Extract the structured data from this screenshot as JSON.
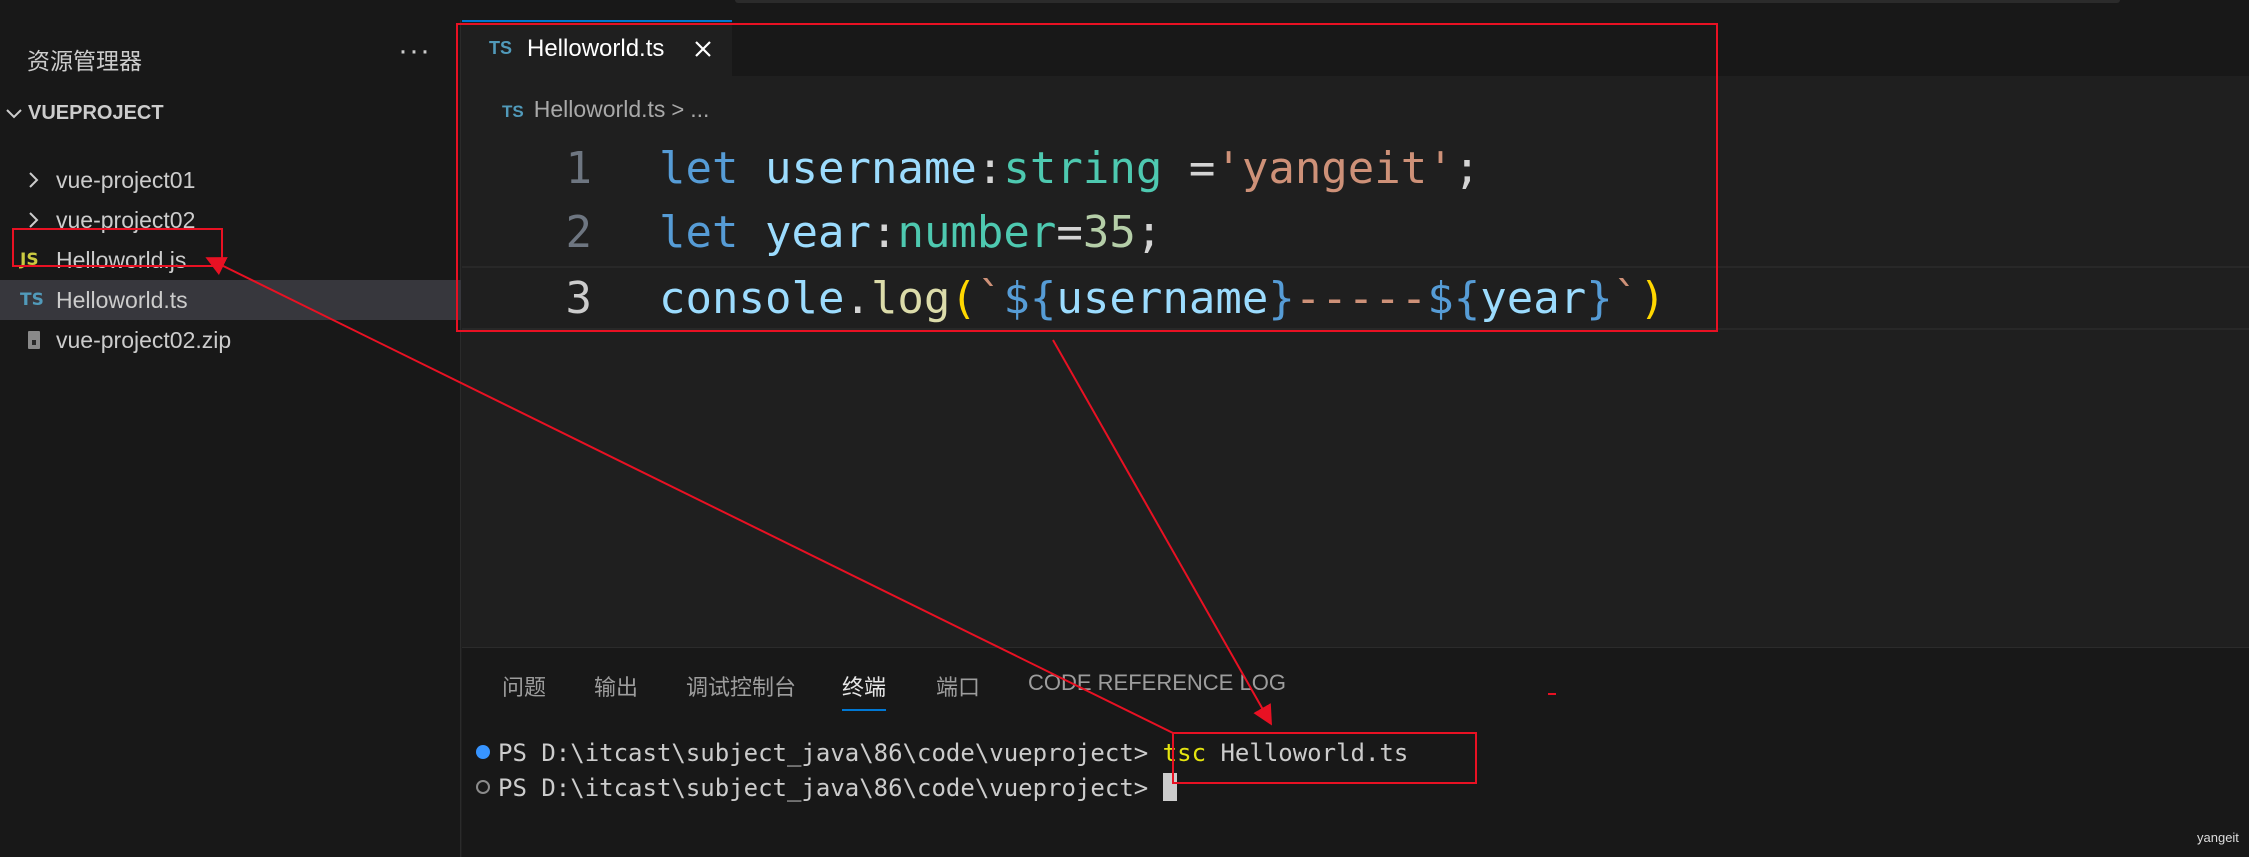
{
  "sidebar": {
    "title": "资源管理器",
    "more_label": "···",
    "section": "VUEPROJECT",
    "items": [
      {
        "label": "vue-project01",
        "kind": "folder"
      },
      {
        "label": "vue-project02",
        "kind": "folder"
      },
      {
        "label": "Helloworld.js",
        "kind": "js",
        "badge": "JS"
      },
      {
        "label": "Helloworld.ts",
        "kind": "ts",
        "badge": "TS"
      },
      {
        "label": "vue-project02.zip",
        "kind": "zip"
      }
    ]
  },
  "editor": {
    "tab": {
      "badge": "TS",
      "label": "Helloworld.ts"
    },
    "breadcrumb": {
      "badge": "TS",
      "file": "Helloworld.ts",
      "sep": ">",
      "more": "..."
    },
    "lines": [
      {
        "num": "1",
        "tokens": {
          "kw": "let",
          "var": "username",
          "colon": ":",
          "type": "string",
          "eq": " =",
          "str": "'yangeit'",
          "semi": ";"
        }
      },
      {
        "num": "2",
        "tokens": {
          "kw": "let",
          "var": "year",
          "colon": ":",
          "type": "number",
          "eq": "=",
          "num": "35",
          "semi": ";"
        }
      },
      {
        "num": "3",
        "tokens": {
          "obj": "console",
          "dot": ".",
          "fn": "log",
          "lparen": "(",
          "tick1": "`",
          "i1open": "${",
          "i1var": "username",
          "i1close": "}",
          "dashes": "-----",
          "i2open": "${",
          "i2var": "year",
          "i2close": "}",
          "tick2": "`",
          "rparen": ")"
        }
      }
    ]
  },
  "panel": {
    "tabs": [
      "问题",
      "输出",
      "调试控制台",
      "终端",
      "端口",
      "CODE REFERENCE LOG"
    ],
    "active_tab": "终端",
    "terminal": [
      {
        "prompt": "PS D:\\itcast\\subject_java\\86\\code\\vueproject>",
        "command": "tsc",
        "args": " Helloworld.ts"
      },
      {
        "prompt": "PS D:\\itcast\\subject_java\\86\\code\\vueproject>",
        "command": "",
        "args": ""
      }
    ]
  },
  "watermark": "yangeit",
  "colors": {
    "annotation": "#e81123",
    "accent": "#0078d4",
    "ts_badge": "#519aba",
    "js_badge": "#cbcb41"
  }
}
